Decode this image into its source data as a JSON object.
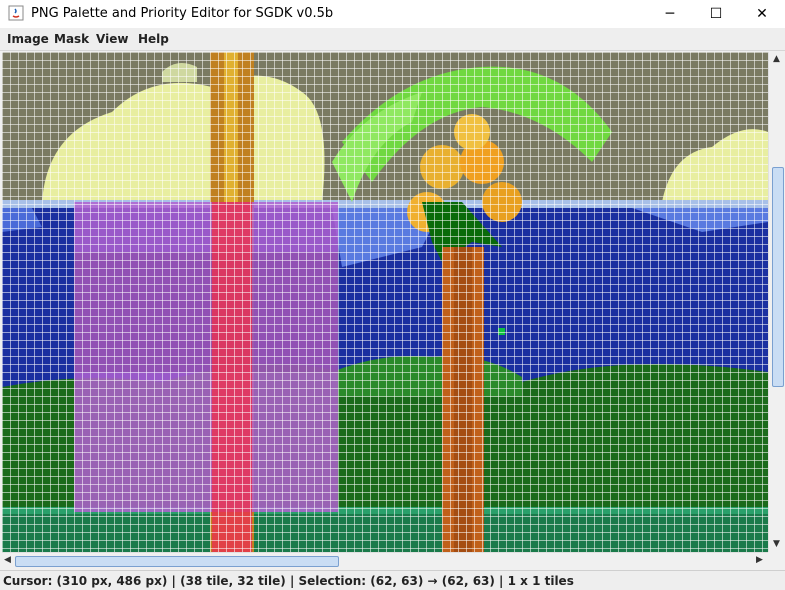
{
  "window": {
    "title": "PNG Palette and Priority Editor for SGDK v0.5b",
    "minimize_glyph": "─",
    "maximize_glyph": "☐",
    "close_glyph": "✕"
  },
  "menu": [
    "Image",
    "Mask",
    "View",
    "Help"
  ],
  "status": "Cursor: (310 px, 486 px) | (38 tile, 32 tile) | Selection: (62, 63) → (62, 63) | 1 x 1 tiles",
  "colors": {
    "sky": "#7a7a62",
    "cloud": "#e8eea0",
    "water": "#1a2fa0",
    "grass": "#1a6a1a",
    "trunk": "#c0601a",
    "leaves": "#70d840",
    "mask_purple": "#b060d0",
    "mask_red": "#e83050"
  }
}
